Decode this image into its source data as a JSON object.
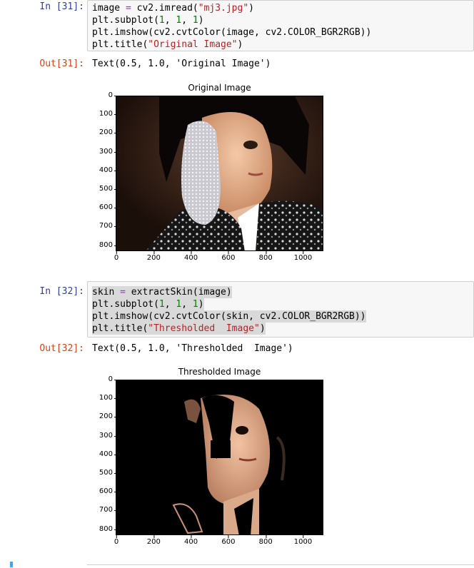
{
  "cell31": {
    "in_prompt": "In [31]:",
    "code": [
      [
        [
          "image ",
          ""
        ],
        [
          "=",
          "op"
        ],
        [
          " cv2.imread(",
          ""
        ],
        [
          "\"mj3.jpg\"",
          "str"
        ],
        [
          ")",
          ""
        ]
      ],
      [
        [
          "plt.subplot(",
          ""
        ],
        [
          "1",
          "num"
        ],
        [
          ", ",
          ""
        ],
        [
          "1",
          "num"
        ],
        [
          ", ",
          ""
        ],
        [
          "1",
          "num"
        ],
        [
          ")",
          ""
        ]
      ],
      [
        [
          "plt.imshow(cv2.cvtColor(image, cv2.COLOR_BGR2RGB))",
          ""
        ]
      ],
      [
        [
          "plt.title(",
          ""
        ],
        [
          "\"Original Image\"",
          "str"
        ],
        [
          ")",
          ""
        ]
      ]
    ],
    "out_prompt": "Out[31]:",
    "out_text": "Text(0.5, 1.0, 'Original Image')",
    "plot_title": "Original Image"
  },
  "cell32": {
    "in_prompt": "In [32]:",
    "code": [
      [
        [
          "skin ",
          ""
        ],
        [
          "=",
          "op"
        ],
        [
          " extractSkin(image)",
          ""
        ]
      ],
      [
        [
          "plt.subplot(",
          ""
        ],
        [
          "1",
          "num"
        ],
        [
          ", ",
          ""
        ],
        [
          "1",
          "num"
        ],
        [
          ", ",
          ""
        ],
        [
          "1",
          "num"
        ],
        [
          ")",
          ""
        ]
      ],
      [
        [
          "plt.imshow(cv2.cvtColor(skin, cv2.COLOR_BGR2RGB))",
          ""
        ]
      ],
      [
        [
          "plt.title(",
          ""
        ],
        [
          "\"Thresholded  Image\"",
          "str"
        ],
        [
          ")",
          ""
        ]
      ]
    ],
    "out_prompt": "Out[32]:",
    "out_text": "Text(0.5, 1.0, 'Thresholded  Image')",
    "plot_title": "Thresholded  Image"
  },
  "axes": {
    "yticks": [
      "0",
      "100",
      "200",
      "300",
      "400",
      "500",
      "600",
      "700",
      "800"
    ],
    "xticks": [
      "0",
      "200",
      "400",
      "600",
      "800",
      "1000"
    ]
  },
  "colors": {
    "in_prompt": "#303f9f",
    "out_prompt": "#d84315",
    "string": "#ba2121",
    "number": "#008000",
    "operator": "#aa22ff",
    "selection": "#d9d9d9",
    "input_bg": "#f7f7f7"
  }
}
